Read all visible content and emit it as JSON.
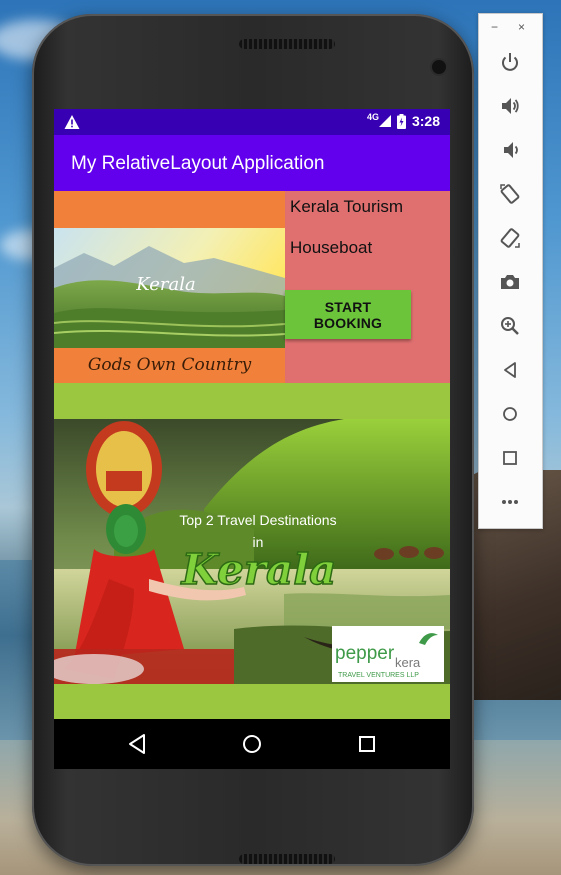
{
  "status_bar": {
    "network": "4G",
    "time": "3:28"
  },
  "app_bar": {
    "title": "My RelativeLayout Application"
  },
  "card_left": {
    "image_word": "Kerala",
    "caption": "Gods Own Country"
  },
  "card_right": {
    "title": "Kerala Tourism",
    "subtitle": "Houseboat",
    "button_label": "START BOOKING"
  },
  "banner": {
    "headline": "Top 2 Travel Destinations",
    "headline_in": "in",
    "big_word": "Kerala",
    "logo_main": "pepper",
    "logo_accent": "kera",
    "logo_sub": "TRAVEL VENTURES LLP"
  },
  "colors": {
    "status_bar": "#3700b3",
    "app_bar": "#6200ee",
    "content_bg": "#9bc63f",
    "left_panel": "#f1813a",
    "right_panel": "#e07070",
    "button": "#6cc43b"
  },
  "emulator_panel": {
    "minimize": "−",
    "close": "×",
    "icons": [
      "power-icon",
      "volume-up-icon",
      "volume-down-icon",
      "rotate-left-icon",
      "rotate-right-icon",
      "camera-icon",
      "zoom-icon",
      "back-icon",
      "home-icon",
      "overview-icon",
      "more-icon"
    ]
  },
  "nav_bar": {
    "icons": [
      "back-triangle-icon",
      "home-circle-icon",
      "recents-square-icon"
    ]
  }
}
